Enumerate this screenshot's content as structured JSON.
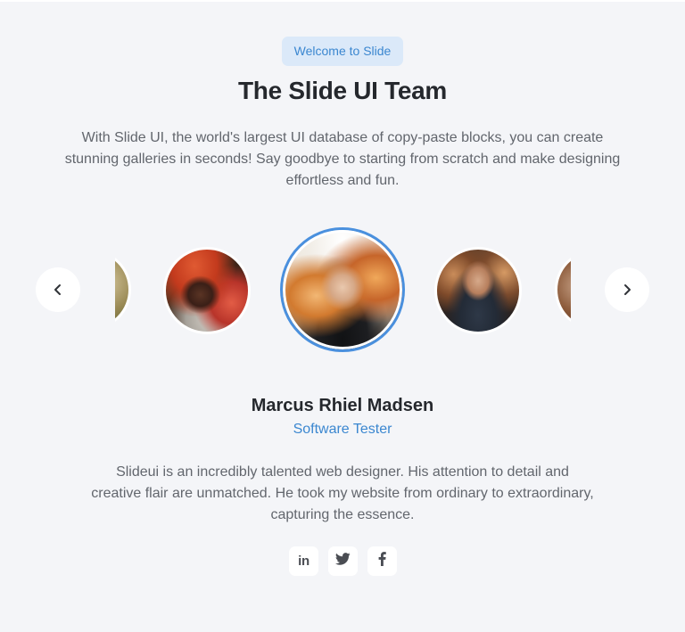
{
  "badge": {
    "label": "Welcome to Slide"
  },
  "header": {
    "title": "The Slide UI Team",
    "description": "With Slide UI, the world's largest UI database of copy-paste blocks, you can create stunning galleries in seconds! Say goodbye to starting from scratch and make designing effortless and fun."
  },
  "carousel": {
    "prev_icon": "chevron-left-icon",
    "next_icon": "chevron-right-icon",
    "active_index": 2,
    "active_ring_color": "#4a90de",
    "avatars": [
      "partial-left",
      "woman-red-hat",
      "woman-flowing-hair",
      "man-suit-glasses",
      "partial-right"
    ]
  },
  "member": {
    "name": "Marcus Rhiel Madsen",
    "role": "Software Tester",
    "quote": "Slideui is an incredibly talented web designer. His attention to detail and creative flair are unmatched. He took my website from ordinary to extraordinary, capturing the essence."
  },
  "socials": {
    "linkedin_label": "in",
    "items": [
      "linkedin-icon",
      "twitter-icon",
      "facebook-icon"
    ]
  },
  "colors": {
    "accent": "#3b87d0",
    "badge_bg": "#dbe9f9",
    "background": "#f4f5f8",
    "heading": "#25282d",
    "body_text": "#62666d"
  }
}
